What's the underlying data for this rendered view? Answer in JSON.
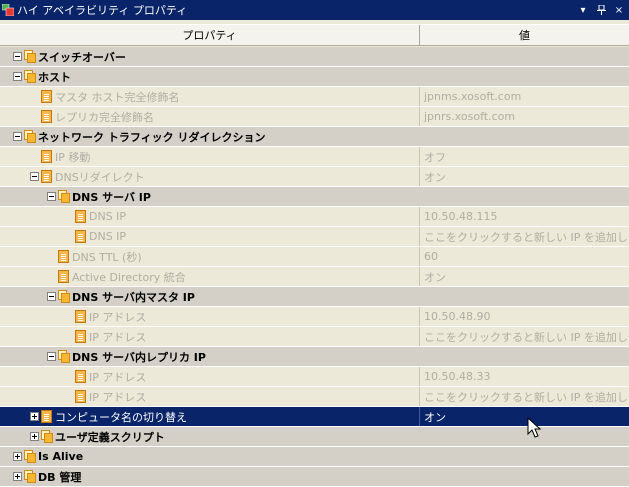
{
  "window": {
    "title": "ハイ アベイラビリティ プロパティ",
    "pin_glyph": "ᵖ",
    "close_glyph": "×",
    "dropdown_glyph": "▾"
  },
  "columns": {
    "property": "プロパティ",
    "value": "値"
  },
  "rows": [
    {
      "kind": "cat",
      "level": 0,
      "expander": "minus",
      "icon": "folder",
      "label": "スイッチオーバー",
      "value": ""
    },
    {
      "kind": "cat",
      "level": 0,
      "expander": "minus",
      "icon": "folder",
      "label": "ホスト",
      "value": ""
    },
    {
      "kind": "item",
      "level": 1,
      "expander": "",
      "icon": "prop",
      "label": "マスタ ホスト完全修飾名",
      "value": "jpnms.xosoft.com"
    },
    {
      "kind": "item",
      "level": 1,
      "expander": "",
      "icon": "prop",
      "label": "レプリカ完全修飾名",
      "value": "jpnrs.xosoft.com"
    },
    {
      "kind": "cat",
      "level": 0,
      "expander": "minus",
      "icon": "folder",
      "label": "ネットワーク トラフィック リダイレクション",
      "value": ""
    },
    {
      "kind": "item",
      "level": 1,
      "expander": "",
      "icon": "prop",
      "label": "IP 移動",
      "value": "オフ"
    },
    {
      "kind": "item",
      "level": 1,
      "expander": "minus",
      "icon": "prop",
      "label": "DNSリダイレクト",
      "value": "オン"
    },
    {
      "kind": "sub",
      "level": 2,
      "expander": "minus",
      "icon": "folder",
      "label": "DNS サーバ IP",
      "value": ""
    },
    {
      "kind": "item",
      "level": 3,
      "expander": "",
      "icon": "prop",
      "label": "DNS IP",
      "value": "10.50.48.115"
    },
    {
      "kind": "item",
      "level": 3,
      "expander": "",
      "icon": "prop",
      "label": "DNS IP",
      "value": "ここをクリックすると新しい IP を追加します。"
    },
    {
      "kind": "item",
      "level": 2,
      "expander": "",
      "icon": "prop",
      "label": "DNS TTL (秒)",
      "value": "60"
    },
    {
      "kind": "item",
      "level": 2,
      "expander": "",
      "icon": "prop",
      "label": "Active Directory 統合",
      "value": "オン"
    },
    {
      "kind": "sub",
      "level": 2,
      "expander": "minus",
      "icon": "folder",
      "label": "DNS サーバ内マスタ IP",
      "value": ""
    },
    {
      "kind": "item",
      "level": 3,
      "expander": "",
      "icon": "prop",
      "label": "IP アドレス",
      "value": "10.50.48.90"
    },
    {
      "kind": "item",
      "level": 3,
      "expander": "",
      "icon": "prop",
      "label": "IP アドレス",
      "value": "ここをクリックすると新しい IP を追加します。"
    },
    {
      "kind": "sub",
      "level": 2,
      "expander": "minus",
      "icon": "folder",
      "label": "DNS サーバ内レプリカ IP",
      "value": ""
    },
    {
      "kind": "item",
      "level": 3,
      "expander": "",
      "icon": "prop",
      "label": "IP アドレス",
      "value": "10.50.48.33"
    },
    {
      "kind": "item",
      "level": 3,
      "expander": "",
      "icon": "prop",
      "label": "IP アドレス",
      "value": "ここをクリックすると新しい IP を追加します。"
    },
    {
      "kind": "sel",
      "level": 1,
      "expander": "plus",
      "icon": "prop",
      "label": "コンピュータ名の切り替え",
      "value": "オン"
    },
    {
      "kind": "cat",
      "level": 1,
      "expander": "plus",
      "icon": "folder",
      "label": "ユーザ定義スクリプト",
      "value": ""
    },
    {
      "kind": "cat",
      "level": 0,
      "expander": "plus",
      "icon": "folder",
      "label": "Is Alive",
      "value": ""
    },
    {
      "kind": "cat",
      "level": 0,
      "expander": "plus",
      "icon": "folder",
      "label": "DB 管理",
      "value": ""
    }
  ]
}
